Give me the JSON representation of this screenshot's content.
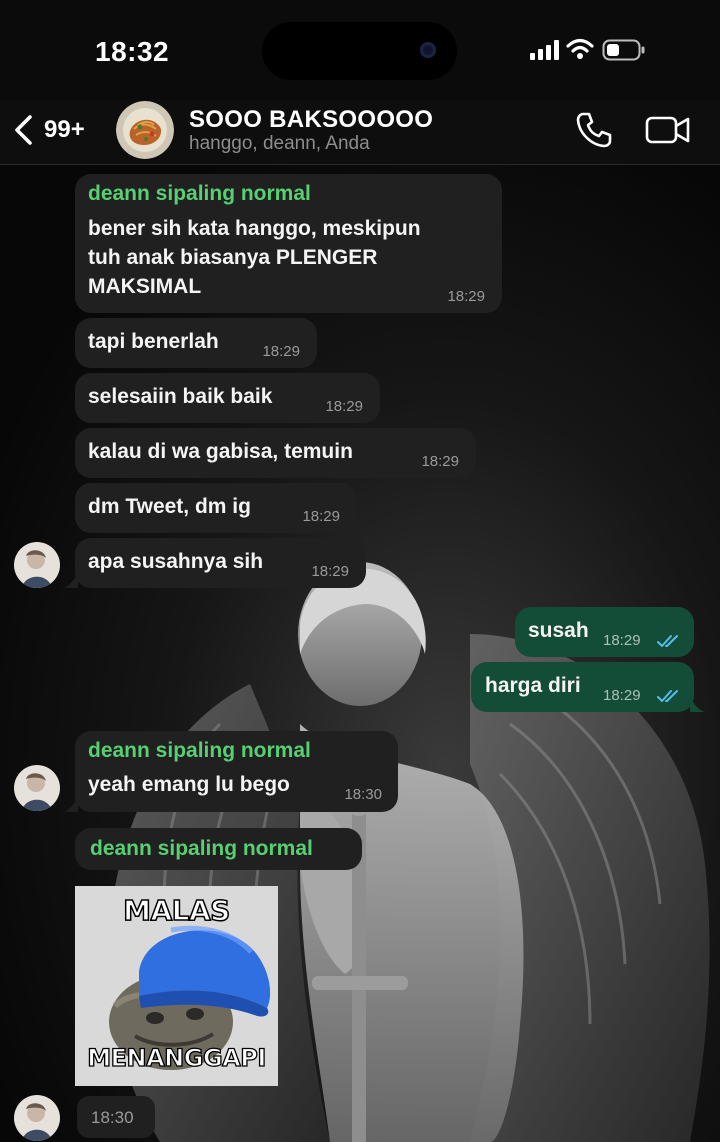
{
  "status_bar": {
    "time": "18:32"
  },
  "header": {
    "back_count": "99+",
    "group_name": "SOOO BAKSOOOOO",
    "members": "hanggo, deann, Anda"
  },
  "messages": [
    {
      "sender": "deann sipaling normal",
      "lines": [
        "bener sih kata hanggo, meskipun",
        "tuh anak biasanya PLENGER",
        "MAKSIMAL"
      ],
      "time": "18:29"
    },
    {
      "text": "tapi benerlah",
      "time": "18:29"
    },
    {
      "text": "selesaiin baik baik",
      "time": "18:29"
    },
    {
      "text": "kalau di wa gabisa, temuin",
      "time": "18:29"
    },
    {
      "text": "dm Tweet, dm ig",
      "time": "18:29"
    },
    {
      "text": "apa susahnya sih",
      "time": "18:29"
    },
    {
      "text": "susah",
      "time": "18:29",
      "outgoing": true
    },
    {
      "text": "harga diri",
      "time": "18:29",
      "outgoing": true
    },
    {
      "sender": "deann sipaling normal",
      "text": "yeah emang lu bego",
      "time": "18:30"
    },
    {
      "sender": "deann sipaling normal",
      "sticker_top": "MALAS",
      "sticker_bottom": "MENANGGAPI",
      "time": "18:30"
    }
  ],
  "colors": {
    "incoming_bubble": "#202020",
    "outgoing_bubble": "#144d37",
    "sender_name": "#57cf72",
    "read_ticks": "#53bdeb"
  },
  "icons": [
    "back-chevron-icon",
    "phone-icon",
    "video-camera-icon",
    "signal-icon",
    "wifi-icon",
    "battery-icon",
    "double-check-icon"
  ]
}
